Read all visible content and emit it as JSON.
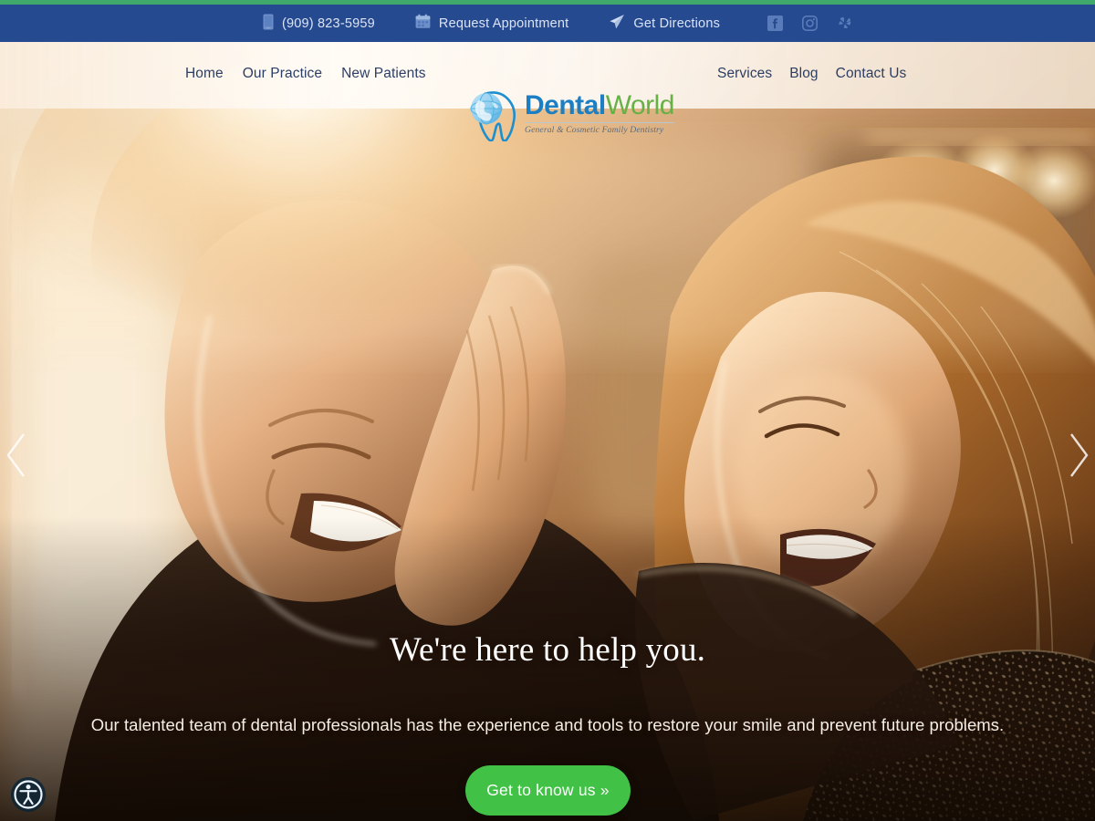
{
  "brand": {
    "name_part1": "Dental",
    "name_part2": "World",
    "tagline": "General & Cosmetic Family Dentistry",
    "logo_icon": "globe-tooth-icon",
    "colors": {
      "blue": "#1d7fc3",
      "green": "#66b145",
      "topbar": "#264a90",
      "accent_strip": "#3fa86b",
      "cta_green": "#41c246",
      "nav_text": "#2c3e63"
    }
  },
  "topbar": {
    "phone": {
      "label": "(909) 823-5959",
      "icon": "mobile-phone-icon"
    },
    "appointment": {
      "label": "Request Appointment",
      "icon": "calendar-icon"
    },
    "directions": {
      "label": "Get Directions",
      "icon": "paper-plane-icon"
    },
    "socials": [
      {
        "name": "facebook",
        "icon": "facebook-icon"
      },
      {
        "name": "instagram",
        "icon": "instagram-icon"
      },
      {
        "name": "yelp",
        "icon": "yelp-icon"
      }
    ]
  },
  "nav": {
    "left_items": [
      {
        "label": "Home"
      },
      {
        "label": "Our Practice"
      },
      {
        "label": "New Patients"
      }
    ],
    "right_items": [
      {
        "label": "Services"
      },
      {
        "label": "Blog"
      },
      {
        "label": "Contact Us"
      }
    ]
  },
  "hero": {
    "title": "We're here to help you.",
    "subtitle": "Our talented team of dental professionals has the experience and tools to restore your smile and prevent future problems.",
    "cta_label": "Get to know us »",
    "prev_icon": "chevron-left-icon",
    "next_icon": "chevron-right-icon",
    "image_alt": "Couple laughing together in warm backlit sunlight"
  },
  "widgets": {
    "accessibility": {
      "icon": "accessibility-icon",
      "label": "Accessibility"
    }
  }
}
